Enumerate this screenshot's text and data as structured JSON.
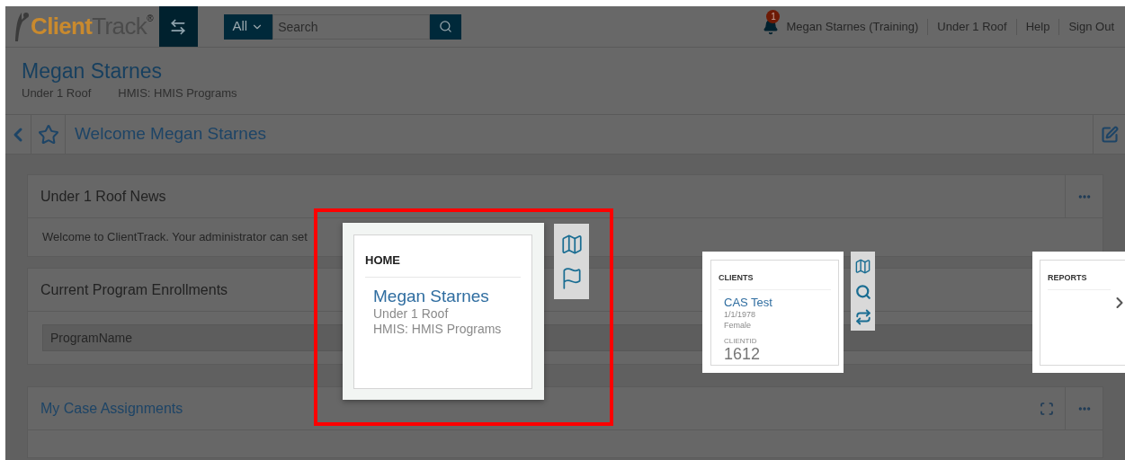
{
  "header": {
    "logo": {
      "part_1": "Client",
      "part_2": "Track",
      "mark": "®"
    },
    "search": {
      "scope": "All",
      "placeholder": "Search"
    },
    "notifications": {
      "count": "1"
    },
    "links": [
      "Megan Starnes (Training)",
      "Under 1 Roof",
      "Help",
      "Sign Out"
    ]
  },
  "client": {
    "name": "Megan Starnes",
    "details": [
      "Under 1 Roof",
      "HMIS: HMIS Programs"
    ]
  },
  "toolbar": {
    "title": "Welcome Megan Starnes"
  },
  "panels": [
    {
      "title": "Under 1 Roof News",
      "link": false,
      "menu": true,
      "expandable": false,
      "kind": "text",
      "body": "Welcome to ClientTrack. Your administrator can set"
    },
    {
      "title": "Current Program Enrollments",
      "link": false,
      "kind": "table",
      "body": "ProgramName"
    },
    {
      "title": "My Case Assignments",
      "link": true,
      "menu": true,
      "expandable": true,
      "kind": "empty"
    }
  ],
  "popup": {
    "highlighted": true,
    "home_card": {
      "heading": "HOME",
      "name": "Megan Starnes",
      "lines": [
        "Under 1 Roof",
        "HMIS: HMIS Programs"
      ]
    },
    "clients_card": {
      "heading": "CLIENTS",
      "name": "CAS Test",
      "lines": [
        "1/1/1978",
        "Female"
      ],
      "id_label": "CLIENTID",
      "id": "1612"
    },
    "reports_card": {
      "heading": "REPORTS"
    }
  }
}
